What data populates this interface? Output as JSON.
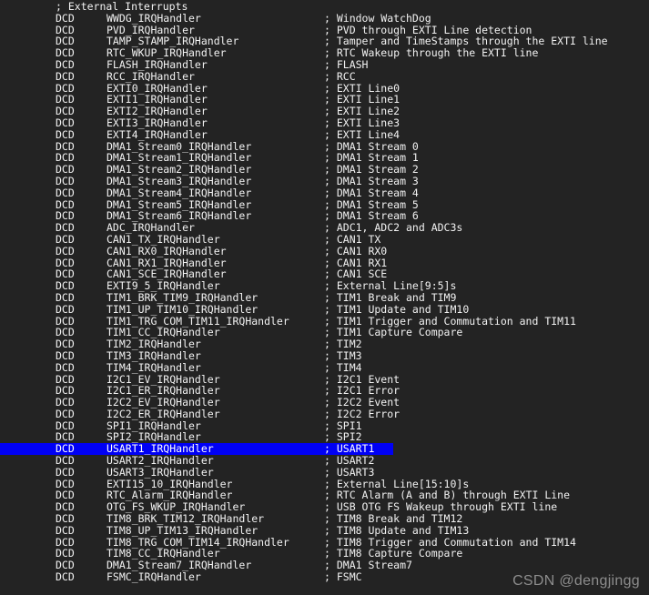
{
  "editor": {
    "background_color": "#232323",
    "text_color": "#f2f2f2",
    "selection_color": "#0000f5",
    "selected_line_index": 40,
    "language": "ARM Assembly"
  },
  "watermark": {
    "text": "CSDN @dengjingg",
    "color": "#8d8d8d"
  },
  "lines": [
    {
      "mnemonic": "",
      "operand": "",
      "comment": "; External Interrupts",
      "comment_only": true
    },
    {
      "mnemonic": "DCD",
      "operand": "WWDG_IRQHandler",
      "comment": "; Window WatchDog"
    },
    {
      "mnemonic": "DCD",
      "operand": "PVD_IRQHandler",
      "comment": "; PVD through EXTI Line detection"
    },
    {
      "mnemonic": "DCD",
      "operand": "TAMP_STAMP_IRQHandler",
      "comment": "; Tamper and TimeStamps through the EXTI line"
    },
    {
      "mnemonic": "DCD",
      "operand": "RTC_WKUP_IRQHandler",
      "comment": "; RTC Wakeup through the EXTI line"
    },
    {
      "mnemonic": "DCD",
      "operand": "FLASH_IRQHandler",
      "comment": "; FLASH"
    },
    {
      "mnemonic": "DCD",
      "operand": "RCC_IRQHandler",
      "comment": "; RCC"
    },
    {
      "mnemonic": "DCD",
      "operand": "EXTI0_IRQHandler",
      "comment": "; EXTI Line0"
    },
    {
      "mnemonic": "DCD",
      "operand": "EXTI1_IRQHandler",
      "comment": "; EXTI Line1"
    },
    {
      "mnemonic": "DCD",
      "operand": "EXTI2_IRQHandler",
      "comment": "; EXTI Line2"
    },
    {
      "mnemonic": "DCD",
      "operand": "EXTI3_IRQHandler",
      "comment": "; EXTI Line3"
    },
    {
      "mnemonic": "DCD",
      "operand": "EXTI4_IRQHandler",
      "comment": "; EXTI Line4"
    },
    {
      "mnemonic": "DCD",
      "operand": "DMA1_Stream0_IRQHandler",
      "comment": "; DMA1 Stream 0"
    },
    {
      "mnemonic": "DCD",
      "operand": "DMA1_Stream1_IRQHandler",
      "comment": "; DMA1 Stream 1"
    },
    {
      "mnemonic": "DCD",
      "operand": "DMA1_Stream2_IRQHandler",
      "comment": "; DMA1 Stream 2"
    },
    {
      "mnemonic": "DCD",
      "operand": "DMA1_Stream3_IRQHandler",
      "comment": "; DMA1 Stream 3"
    },
    {
      "mnemonic": "DCD",
      "operand": "DMA1_Stream4_IRQHandler",
      "comment": "; DMA1 Stream 4"
    },
    {
      "mnemonic": "DCD",
      "operand": "DMA1_Stream5_IRQHandler",
      "comment": "; DMA1 Stream 5"
    },
    {
      "mnemonic": "DCD",
      "operand": "DMA1_Stream6_IRQHandler",
      "comment": "; DMA1 Stream 6"
    },
    {
      "mnemonic": "DCD",
      "operand": "ADC_IRQHandler",
      "comment": "; ADC1, ADC2 and ADC3s"
    },
    {
      "mnemonic": "DCD",
      "operand": "CAN1_TX_IRQHandler",
      "comment": "; CAN1 TX"
    },
    {
      "mnemonic": "DCD",
      "operand": "CAN1_RX0_IRQHandler",
      "comment": "; CAN1 RX0"
    },
    {
      "mnemonic": "DCD",
      "operand": "CAN1_RX1_IRQHandler",
      "comment": "; CAN1 RX1"
    },
    {
      "mnemonic": "DCD",
      "operand": "CAN1_SCE_IRQHandler",
      "comment": "; CAN1 SCE"
    },
    {
      "mnemonic": "DCD",
      "operand": "EXTI9_5_IRQHandler",
      "comment": "; External Line[9:5]s"
    },
    {
      "mnemonic": "DCD",
      "operand": "TIM1_BRK_TIM9_IRQHandler",
      "comment": "; TIM1 Break and TIM9"
    },
    {
      "mnemonic": "DCD",
      "operand": "TIM1_UP_TIM10_IRQHandler",
      "comment": "; TIM1 Update and TIM10"
    },
    {
      "mnemonic": "DCD",
      "operand": "TIM1_TRG_COM_TIM11_IRQHandler",
      "comment": "; TIM1 Trigger and Commutation and TIM11"
    },
    {
      "mnemonic": "DCD",
      "operand": "TIM1_CC_IRQHandler",
      "comment": "; TIM1 Capture Compare"
    },
    {
      "mnemonic": "DCD",
      "operand": "TIM2_IRQHandler",
      "comment": "; TIM2"
    },
    {
      "mnemonic": "DCD",
      "operand": "TIM3_IRQHandler",
      "comment": "; TIM3"
    },
    {
      "mnemonic": "DCD",
      "operand": "TIM4_IRQHandler",
      "comment": "; TIM4"
    },
    {
      "mnemonic": "DCD",
      "operand": "I2C1_EV_IRQHandler",
      "comment": "; I2C1 Event"
    },
    {
      "mnemonic": "DCD",
      "operand": "I2C1_ER_IRQHandler",
      "comment": "; I2C1 Error"
    },
    {
      "mnemonic": "DCD",
      "operand": "I2C2_EV_IRQHandler",
      "comment": "; I2C2 Event"
    },
    {
      "mnemonic": "DCD",
      "operand": "I2C2_ER_IRQHandler",
      "comment": "; I2C2 Error"
    },
    {
      "mnemonic": "DCD",
      "operand": "SPI1_IRQHandler",
      "comment": "; SPI1"
    },
    {
      "mnemonic": "DCD",
      "operand": "SPI2_IRQHandler",
      "comment": "; SPI2"
    },
    {
      "mnemonic": "DCD",
      "operand": "USART1_IRQHandler",
      "comment": "; USART1",
      "selected": true
    },
    {
      "mnemonic": "DCD",
      "operand": "USART2_IRQHandler",
      "comment": "; USART2"
    },
    {
      "mnemonic": "DCD",
      "operand": "USART3_IRQHandler",
      "comment": "; USART3"
    },
    {
      "mnemonic": "DCD",
      "operand": "EXTI15_10_IRQHandler",
      "comment": "; External Line[15:10]s"
    },
    {
      "mnemonic": "DCD",
      "operand": "RTC_Alarm_IRQHandler",
      "comment": "; RTC Alarm (A and B) through EXTI Line"
    },
    {
      "mnemonic": "DCD",
      "operand": "OTG_FS_WKUP_IRQHandler",
      "comment": "; USB OTG FS Wakeup through EXTI line"
    },
    {
      "mnemonic": "DCD",
      "operand": "TIM8_BRK_TIM12_IRQHandler",
      "comment": "; TIM8 Break and TIM12"
    },
    {
      "mnemonic": "DCD",
      "operand": "TIM8_UP_TIM13_IRQHandler",
      "comment": "; TIM8 Update and TIM13"
    },
    {
      "mnemonic": "DCD",
      "operand": "TIM8_TRG_COM_TIM14_IRQHandler",
      "comment": "; TIM8 Trigger and Commutation and TIM14"
    },
    {
      "mnemonic": "DCD",
      "operand": "TIM8_CC_IRQHandler",
      "comment": "; TIM8 Capture Compare"
    },
    {
      "mnemonic": "DCD",
      "operand": "DMA1_Stream7_IRQHandler",
      "comment": "; DMA1 Stream7"
    },
    {
      "mnemonic": "DCD",
      "operand": "FSMC_IRQHandler",
      "comment": "; FSMC"
    }
  ]
}
